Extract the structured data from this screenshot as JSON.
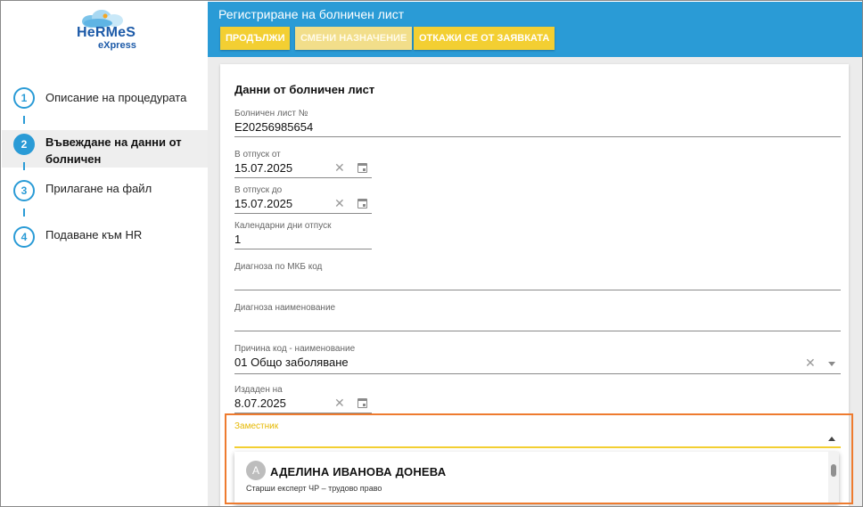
{
  "logo": {
    "line1": "HeRMeS",
    "line2": "eXpress"
  },
  "steps": [
    {
      "number": "1",
      "label": "Описание на процедурата"
    },
    {
      "number": "2",
      "label": "Въвеждане на данни от болничен"
    },
    {
      "number": "3",
      "label": "Прилагане на файл"
    },
    {
      "number": "4",
      "label": "Подаване към HR"
    }
  ],
  "header": {
    "title": "Регистриране на болничен лист",
    "buttons": {
      "continue": "ПРОДЪЛЖИ",
      "change_assignment": "СМЕНИ НАЗНАЧЕНИЕ",
      "cancel_request": "ОТКАЖИ СЕ ОТ ЗАЯВКАТА"
    }
  },
  "form": {
    "section_title": "Данни от болничен лист",
    "sick_leave_no": {
      "label": "Болничен лист №",
      "value": "Е20256985654"
    },
    "leave_from": {
      "label": "В отпуск от",
      "value": "15.07.2025"
    },
    "leave_to": {
      "label": "В отпуск до",
      "value": "15.07.2025"
    },
    "calendar_days": {
      "label": "Календарни дни отпуск",
      "value": "1"
    },
    "diagnosis_code": {
      "label": "Диагноза по МКБ код",
      "value": ""
    },
    "diagnosis_name": {
      "label": "Диагноза наименование",
      "value": ""
    },
    "reason": {
      "label": "Причина код - наименование",
      "value": "01 Общо заболяване"
    },
    "issued_on": {
      "label": "Издаден на",
      "value": "8.07.2025"
    },
    "deputy": {
      "label": "Заместник",
      "value": ""
    }
  },
  "dropdown": {
    "items": [
      {
        "initial": "А",
        "name": "АДЕЛИНА ИВАНОВА ДОНЕВА",
        "subtitle": "Старши експерт ЧР – трудово право"
      }
    ]
  },
  "colors": {
    "accent": "#2a9bd6",
    "button": "#f3cf32",
    "highlight": "#ee7b2f",
    "focus": "#f3cf32"
  }
}
